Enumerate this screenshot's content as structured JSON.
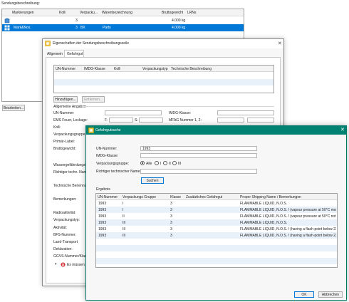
{
  "main": {
    "section_label": "Sendungsbeschreibung:",
    "table": {
      "headers": [
        "Markierungen",
        "Kolli",
        "Verpacku...",
        "Warenbezeichnung",
        "Bruttogewicht",
        "LRNs"
      ],
      "rows": [
        {
          "icon": "package-icon",
          "markierungen": "",
          "kolli": "3",
          "verpackung": "",
          "ware": "",
          "gewicht": "4.000 kg",
          "lrns": ""
        },
        {
          "icon": "pallet-icon",
          "markierungen": "Mark&Nos.",
          "kolli": "3",
          "verpackung": "BX",
          "ware": "Parts",
          "gewicht": "4.000 kg",
          "lrns": ""
        }
      ]
    },
    "edit_button": "Bearbeiten..."
  },
  "props_dialog": {
    "title": "Eigenschaften der Sendungsbeschreibungszeile",
    "tabs": [
      "Allgemein",
      "Gefahrgut"
    ],
    "un_table_headers": [
      "UN-Nummer",
      "IMDG-Klasse",
      "Kolli",
      "Verpackungstyp",
      "Technische Beschreibung"
    ],
    "add_button": "Hinzufügen...",
    "remove_button": "Entfernen...",
    "section": "Allgemeine Angaben",
    "labels": {
      "un": "UN-Nummer:",
      "imdg": "IMDG-Klasse:",
      "ems": "EMS Feuer, Leckage:",
      "ems_f": "F-",
      "ems_s": "S-",
      "mfag": "MFAG Nummer 1, 2:",
      "kolli": "Kolli",
      "verpackungsgruppe": "Verpackungsgruppe:",
      "primaer": "Primär-Label:",
      "brutto": "Bruttogewicht:",
      "wasser": "Wassergefährdungskl",
      "techname": "Richtiger techn. Name",
      "technbenennung": "Technische Benennun",
      "bemerkungen": "Bemerkungen:",
      "radioakt": "Radioaktivität:",
      "verpackungstyp": "Verpackungstyp:",
      "aktivitaet": "Aktivität:",
      "bfs": "BFS-Nummer:",
      "landtransport": "Land-Transport",
      "deklaration": "Deklaration:",
      "ggvs": "GGVS-Nummer/Klass"
    },
    "error_text": "Es müssen All"
  },
  "search_dialog": {
    "title": "Gefahrgutsuche",
    "un_label": "UN-Nummer:",
    "un_value": "1993",
    "imdg_label": "IMDG-Klasse:",
    "group_label": "Verpackungsgruppe:",
    "radio_options": [
      "Alle",
      "I",
      "II",
      "III"
    ],
    "selected_radio": "Alle",
    "techname_label": "Richtiger technischer Name:",
    "search_button": "Suchen",
    "results_label": "Ergebnis",
    "results_headers": [
      "UN-Nummer",
      "Verpackungs Gruppe",
      "Klasse",
      "Zusätzliches Gefahrgut",
      "Proper Shipping Name / Bemerkungen"
    ],
    "results": [
      {
        "un": "1993",
        "gruppe": "I",
        "klasse": "3",
        "zusatz": "",
        "name": "FLAMMABLE LIQUID, N.O.S."
      },
      {
        "un": "1993",
        "gruppe": "I",
        "klasse": "3",
        "zusatz": "",
        "name": "FLAMMABLE LIQUID, N.O.S. / (vapour pressure at 50°C more..."
      },
      {
        "un": "1993",
        "gruppe": "II",
        "klasse": "3",
        "zusatz": "",
        "name": "FLAMMABLE LIQUID, N.O.S. / (vapour pressure at 50°C not ..."
      },
      {
        "un": "1993",
        "gruppe": "III",
        "klasse": "3",
        "zusatz": "",
        "name": "FLAMMABLE LIQUID, N.O.S."
      },
      {
        "un": "1993",
        "gruppe": "III",
        "klasse": "3",
        "zusatz": "",
        "name": "FLAMMABLE LIQUID, N.O.S. / (having a flash-point below 23..."
      },
      {
        "un": "1993",
        "gruppe": "III",
        "klasse": "3",
        "zusatz": "",
        "name": "FLAMMABLE LIQUID, N.O.S. / (having a flash-point below 23..."
      }
    ],
    "ok_button": "OK",
    "cancel_button": "Abbrechen"
  },
  "colors": {
    "selection": "#0078d7",
    "dialog_title_bar": "#008272",
    "error": "#d13438",
    "alt_row": "#e8f0fa"
  }
}
